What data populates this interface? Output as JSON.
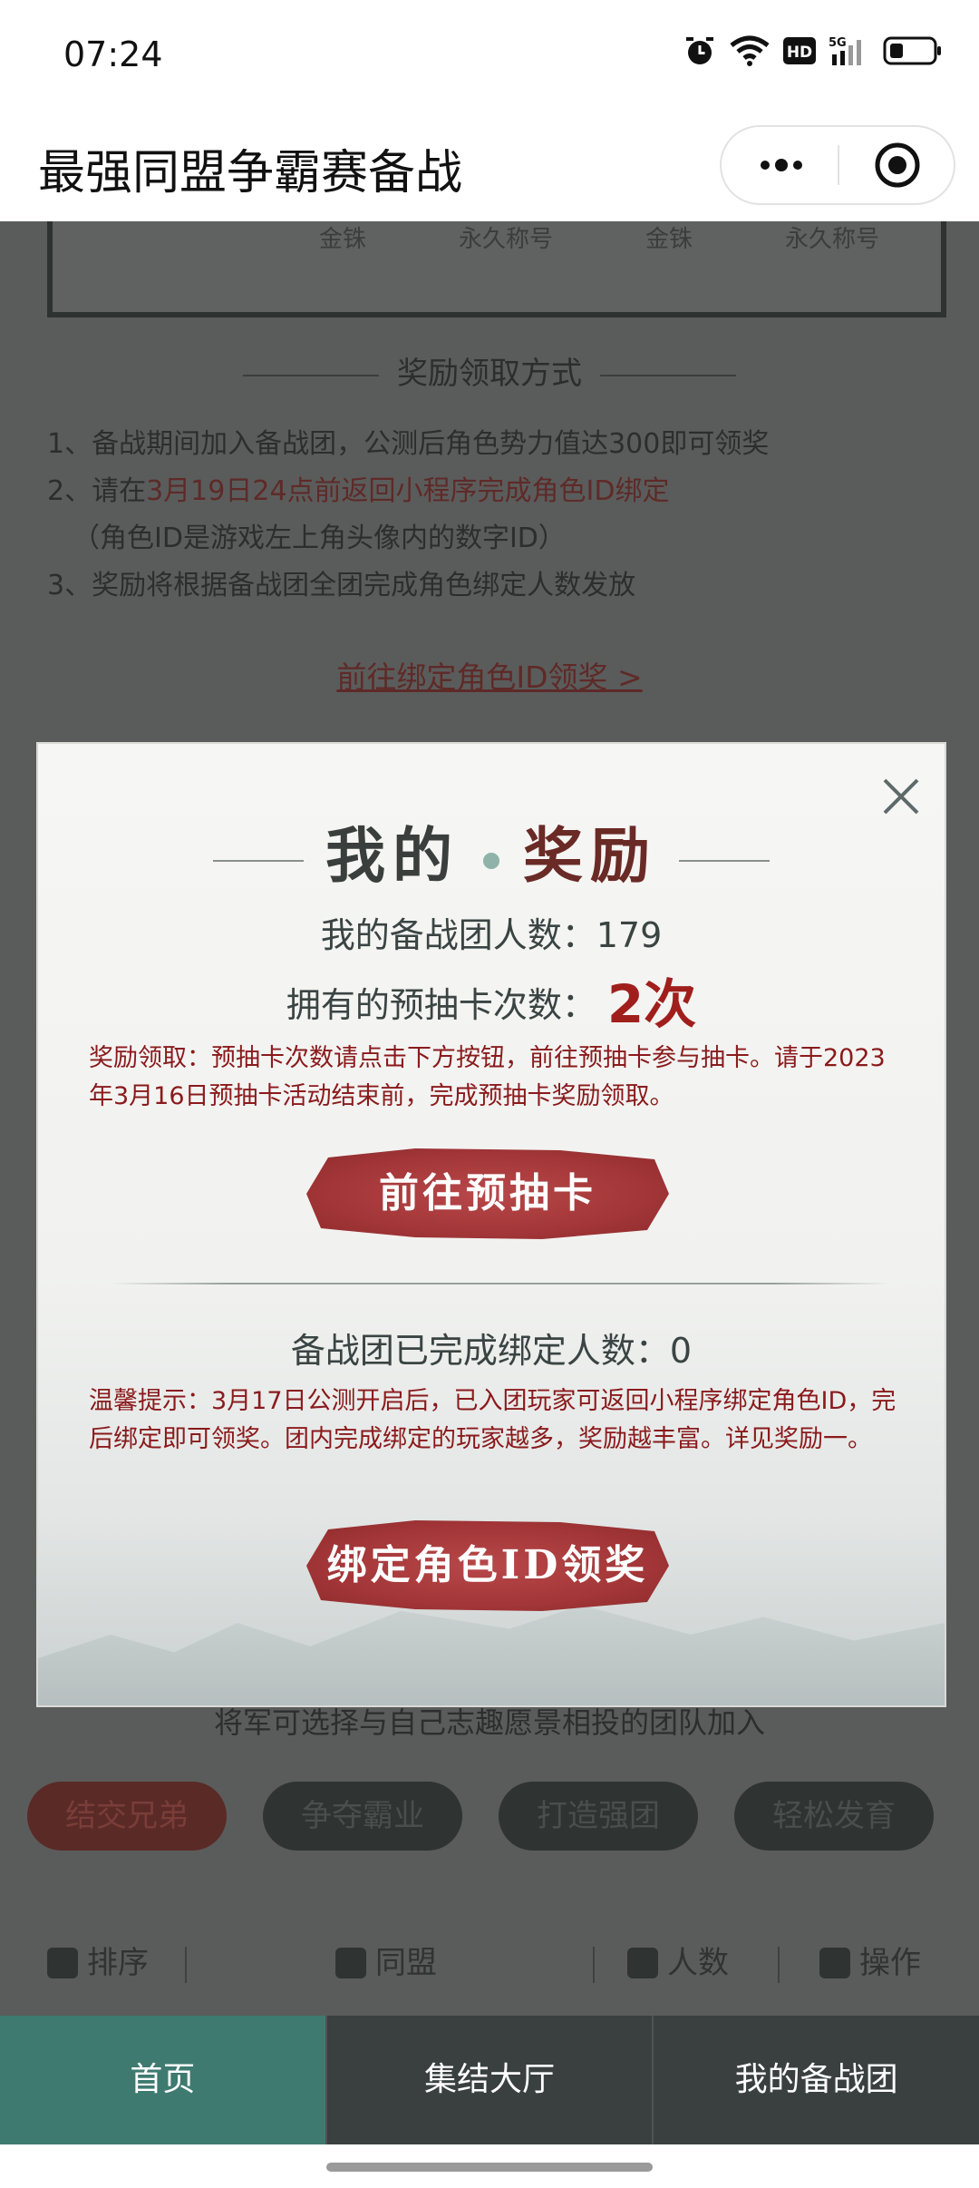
{
  "status_bar": {
    "time": "07:24"
  },
  "titlebar": {
    "title": "最强同盟争霸赛备战"
  },
  "background": {
    "rank_table_cells": [
      "金铢",
      "永久称号",
      "金铢",
      "永久称号"
    ],
    "section_heading": "奖励领取方式",
    "rules": [
      "1、备战期间加入备战团，公测后角色势力值达300即可领奖",
      "2、请在",
      "3月19日24点前返回小程序完成角色ID绑定",
      "（角色ID是游戏左上角头像内的数字ID）",
      "3、奖励将根据备战团全团完成角色绑定人数发放"
    ],
    "bind_link": "前往绑定角色ID领奖 >",
    "join_caption": "将军可选择与自己志趣愿景相投的团队加入",
    "team_tags": [
      "结交兄弟",
      "争夺霸业",
      "打造强团",
      "轻松发育"
    ],
    "table_headers": [
      "排序",
      "同盟",
      "人数",
      "操作"
    ]
  },
  "modal": {
    "title_part1": "我的",
    "title_part2": "奖励",
    "members_label": "我的备战团人数：179",
    "cards_label": "拥有的预抽卡次数：",
    "cards_count": "2次",
    "note1": "奖励领取：预抽卡次数请点击下方按钮，前往预抽卡参与抽卡。请于2023年3月16日预抽卡活动结束前，完成预抽卡奖励领取。",
    "draw_button": "前往预抽卡",
    "bound_label": "备战团已完成绑定人数：0",
    "note2": "温馨提示：3月17日公测开启后，已入团玩家可返回小程序绑定角色ID，完后绑定即可领奖。团内完成绑定的玩家越多，奖励越丰富。详见奖励一。",
    "bind_button": "绑定角色ID领奖"
  },
  "tabbar": {
    "tabs": [
      "首页",
      "集结大厅",
      "我的备战团"
    ]
  },
  "colors": {
    "accent_red": "#a01f1c",
    "tab_active": "#3e7a70",
    "note_red": "#8a1a1c"
  }
}
